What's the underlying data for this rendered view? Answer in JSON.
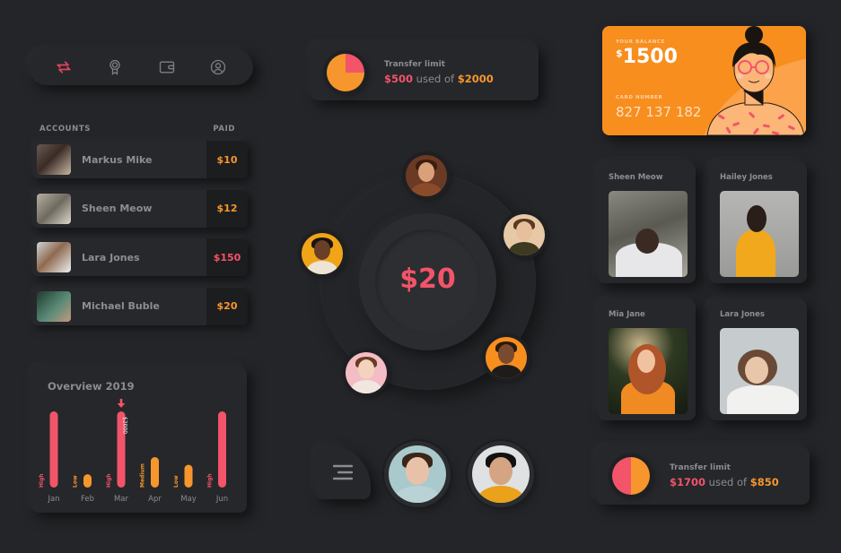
{
  "nav": {
    "items": [
      {
        "icon": "transfer-arrows-icon",
        "active": true
      },
      {
        "icon": "award-badge-icon",
        "active": false
      },
      {
        "icon": "wallet-icon",
        "active": false
      },
      {
        "icon": "user-profile-icon",
        "active": false
      }
    ]
  },
  "colors": {
    "accent_red": "#f2546a",
    "accent_orange": "#f7962d",
    "background": "#232528",
    "card_orange": "#f78e1e"
  },
  "accounts": {
    "header_label": "ACCOUNTS",
    "paid_label": "PAID",
    "rows": [
      {
        "name": "Markus Mike",
        "paid": "$10",
        "paid_color": "orange"
      },
      {
        "name": "Sheen Meow",
        "paid": "$12",
        "paid_color": "orange"
      },
      {
        "name": "Lara Jones",
        "paid": "$150",
        "paid_color": "red"
      },
      {
        "name": "Michael Buble",
        "paid": "$20",
        "paid_color": "orange"
      }
    ]
  },
  "overview": {
    "title": "Overview 2019"
  },
  "chart_data": {
    "type": "bar",
    "title": "Overview 2019",
    "categories": [
      "Jan",
      "Feb",
      "Mar",
      "Apr",
      "May",
      "Jun"
    ],
    "levels": [
      "High",
      "Low",
      "High",
      "Medium",
      "Low",
      "High"
    ],
    "values": [
      2000,
      350,
      2000,
      800,
      600,
      2000
    ],
    "highlighted": {
      "category": "Mar",
      "label": "$2000"
    },
    "ylim": [
      0,
      2000
    ],
    "xlabel": "",
    "ylabel": "",
    "grid": false,
    "legend": "none"
  },
  "transfer_limit_top": {
    "label": "Transfer limit",
    "used": "$500",
    "middle": "used of",
    "total": "$2000",
    "used_fraction": 0.25
  },
  "transfer_limit_bottom": {
    "label": "Transfer limit",
    "used": "$1700",
    "middle": "used of",
    "total": "$850",
    "used_fraction": 0.5
  },
  "balance_card": {
    "balance_label": "YOUR BALANCE",
    "currency": "$",
    "balance": "1500",
    "card_number_label": "CARD NUMBER",
    "card_number": "827 137 182"
  },
  "center": {
    "amount": "$20"
  },
  "people_grid": [
    {
      "name": "Sheen Meow"
    },
    {
      "name": "Hailey Jones"
    },
    {
      "name": "Mia Jane"
    },
    {
      "name": "Lara Jones"
    }
  ]
}
